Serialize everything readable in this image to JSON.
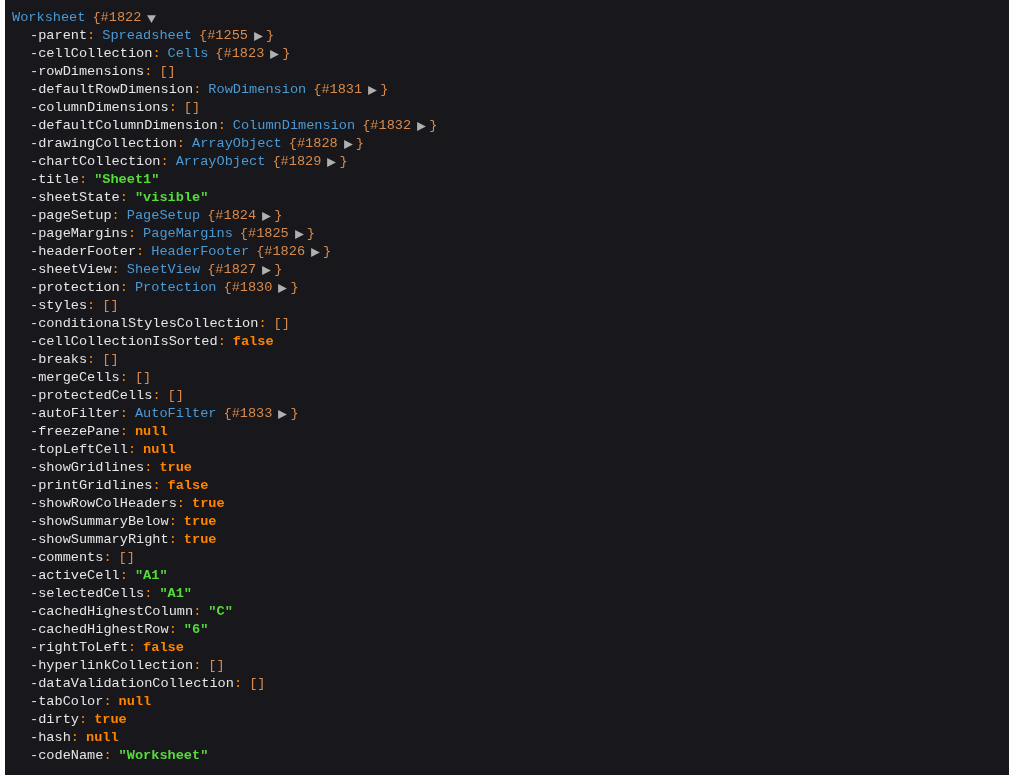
{
  "dump": {
    "class": "Worksheet",
    "open": "{#1822",
    "expanded": true,
    "properties": [
      {
        "key": "-parent",
        "sep": ":",
        "kind": "object",
        "value": "Spreadsheet",
        "open": "{#1255",
        "expanded": false,
        "close": "}"
      },
      {
        "key": "-cellCollection",
        "sep": ":",
        "kind": "object",
        "value": "Cells",
        "open": "{#1823",
        "expanded": false,
        "close": "}"
      },
      {
        "key": "-rowDimensions",
        "sep": ":",
        "kind": "array",
        "value": "[]"
      },
      {
        "key": "-defaultRowDimension",
        "sep": ":",
        "kind": "object",
        "value": "RowDimension",
        "open": "{#1831",
        "expanded": false,
        "close": "}"
      },
      {
        "key": "-columnDimensions",
        "sep": ":",
        "kind": "array",
        "value": "[]"
      },
      {
        "key": "-defaultColumnDimension",
        "sep": ":",
        "kind": "object",
        "value": "ColumnDimension",
        "open": "{#1832",
        "expanded": false,
        "close": "}"
      },
      {
        "key": "-drawingCollection",
        "sep": ":",
        "kind": "object",
        "value": "ArrayObject",
        "open": "{#1828",
        "expanded": false,
        "close": "}"
      },
      {
        "key": "-chartCollection",
        "sep": ":",
        "kind": "object",
        "value": "ArrayObject",
        "open": "{#1829",
        "expanded": false,
        "close": "}"
      },
      {
        "key": "-title",
        "sep": ":",
        "kind": "string",
        "value": "\"Sheet1\""
      },
      {
        "key": "-sheetState",
        "sep": ":",
        "kind": "string",
        "value": "\"visible\""
      },
      {
        "key": "-pageSetup",
        "sep": ":",
        "kind": "object",
        "value": "PageSetup",
        "open": "{#1824",
        "expanded": false,
        "close": "}"
      },
      {
        "key": "-pageMargins",
        "sep": ":",
        "kind": "object",
        "value": "PageMargins",
        "open": "{#1825",
        "expanded": false,
        "close": "}"
      },
      {
        "key": "-headerFooter",
        "sep": ":",
        "kind": "object",
        "value": "HeaderFooter",
        "open": "{#1826",
        "expanded": false,
        "close": "}"
      },
      {
        "key": "-sheetView",
        "sep": ":",
        "kind": "object",
        "value": "SheetView",
        "open": "{#1827",
        "expanded": false,
        "close": "}"
      },
      {
        "key": "-protection",
        "sep": ":",
        "kind": "object",
        "value": "Protection",
        "open": "{#1830",
        "expanded": false,
        "close": "}"
      },
      {
        "key": "-styles",
        "sep": ":",
        "kind": "array",
        "value": "[]"
      },
      {
        "key": "-conditionalStylesCollection",
        "sep": ":",
        "kind": "array",
        "value": "[]"
      },
      {
        "key": "-cellCollectionIsSorted",
        "sep": ":",
        "kind": "constant",
        "value": "false"
      },
      {
        "key": "-breaks",
        "sep": ":",
        "kind": "array",
        "value": "[]"
      },
      {
        "key": "-mergeCells",
        "sep": ":",
        "kind": "array",
        "value": "[]"
      },
      {
        "key": "-protectedCells",
        "sep": ":",
        "kind": "array",
        "value": "[]"
      },
      {
        "key": "-autoFilter",
        "sep": ":",
        "kind": "object",
        "value": "AutoFilter",
        "open": "{#1833",
        "expanded": false,
        "close": "}"
      },
      {
        "key": "-freezePane",
        "sep": ":",
        "kind": "constant",
        "value": "null"
      },
      {
        "key": "-topLeftCell",
        "sep": ":",
        "kind": "constant",
        "value": "null"
      },
      {
        "key": "-showGridlines",
        "sep": ":",
        "kind": "constant",
        "value": "true"
      },
      {
        "key": "-printGridlines",
        "sep": ":",
        "kind": "constant",
        "value": "false"
      },
      {
        "key": "-showRowColHeaders",
        "sep": ":",
        "kind": "constant",
        "value": "true"
      },
      {
        "key": "-showSummaryBelow",
        "sep": ":",
        "kind": "constant",
        "value": "true"
      },
      {
        "key": "-showSummaryRight",
        "sep": ":",
        "kind": "constant",
        "value": "true"
      },
      {
        "key": "-comments",
        "sep": ":",
        "kind": "array",
        "value": "[]"
      },
      {
        "key": "-activeCell",
        "sep": ":",
        "kind": "string",
        "value": "\"A1\""
      },
      {
        "key": "-selectedCells",
        "sep": ":",
        "kind": "string",
        "value": "\"A1\""
      },
      {
        "key": "-cachedHighestColumn",
        "sep": ":",
        "kind": "string",
        "value": "\"C\""
      },
      {
        "key": "-cachedHighestRow",
        "sep": ":",
        "kind": "string",
        "value": "\"6\""
      },
      {
        "key": "-rightToLeft",
        "sep": ":",
        "kind": "constant",
        "value": "false"
      },
      {
        "key": "-hyperlinkCollection",
        "sep": ":",
        "kind": "array",
        "value": "[]"
      },
      {
        "key": "-dataValidationCollection",
        "sep": ":",
        "kind": "array",
        "value": "[]"
      },
      {
        "key": "-tabColor",
        "sep": ":",
        "kind": "constant",
        "value": "null"
      },
      {
        "key": "-dirty",
        "sep": ":",
        "kind": "constant",
        "value": "true"
      },
      {
        "key": "-hash",
        "sep": ":",
        "kind": "constant",
        "value": "null"
      },
      {
        "key": "-codeName",
        "sep": ":",
        "kind": "string",
        "value": "\"Worksheet\""
      }
    ]
  }
}
